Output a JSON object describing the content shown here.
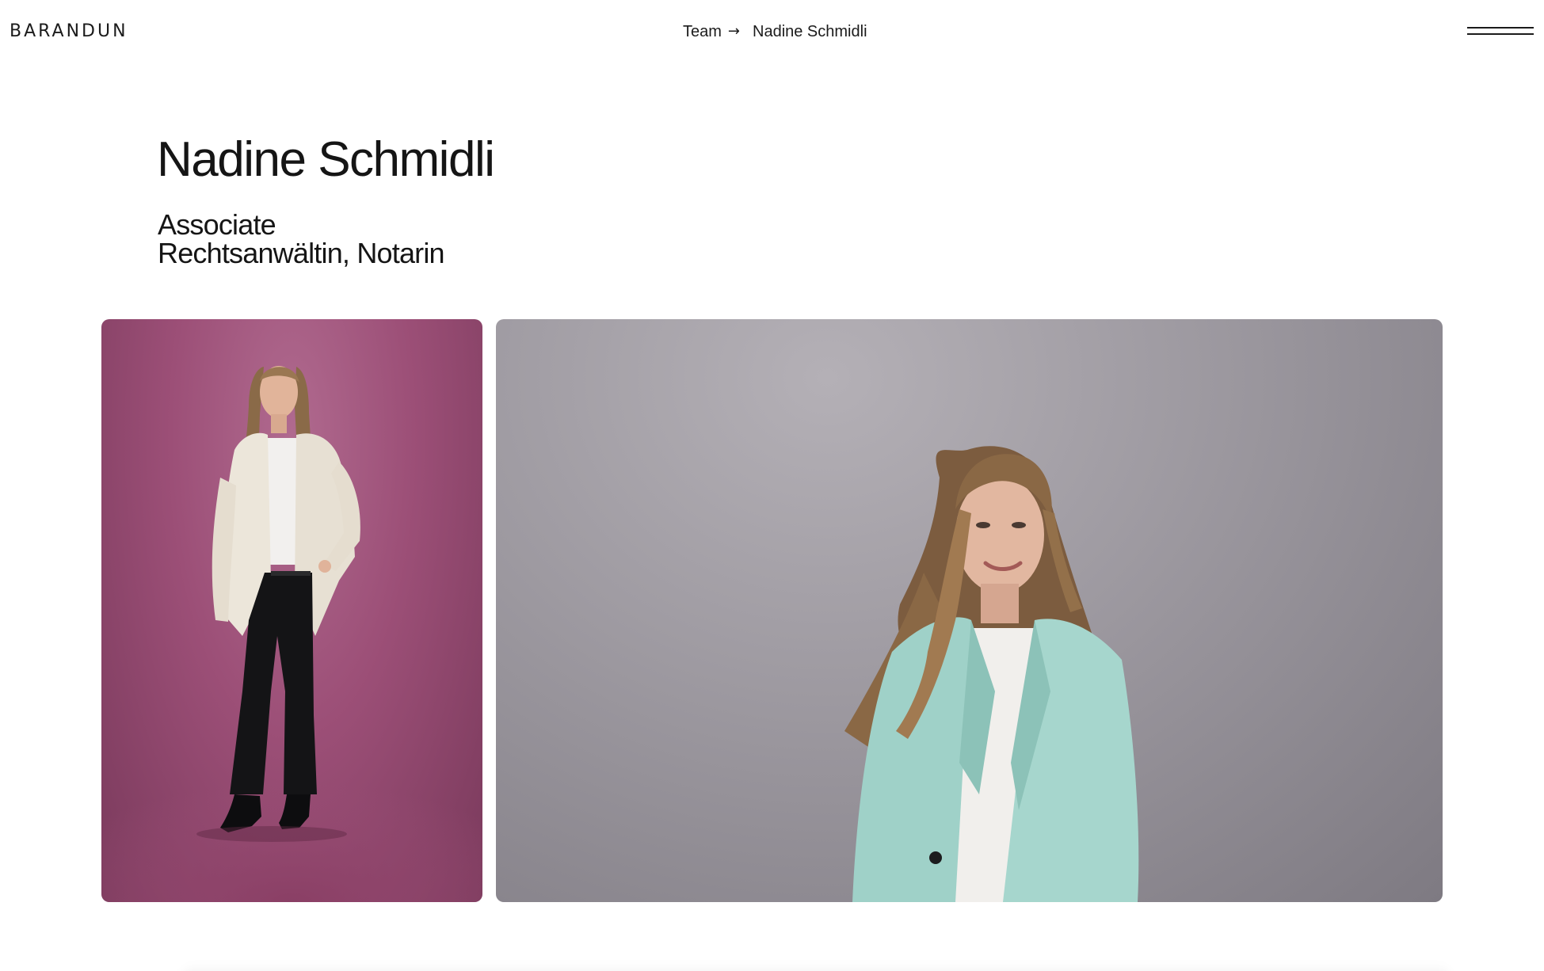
{
  "header": {
    "logo": "BARANDUN",
    "breadcrumb": {
      "parent": "Team",
      "separator": "→",
      "current": "Nadine Schmidli"
    },
    "menu_icon": "hamburger-menu-icon"
  },
  "profile": {
    "name": "Nadine Schmidli",
    "roles": [
      "Associate",
      "Rechtsanwältin, Notarin"
    ]
  },
  "photos": [
    {
      "name": "full-body-portrait",
      "background_color": "#9c4f77"
    },
    {
      "name": "headshot-portrait",
      "background_color": "#9f9ba2"
    }
  ]
}
